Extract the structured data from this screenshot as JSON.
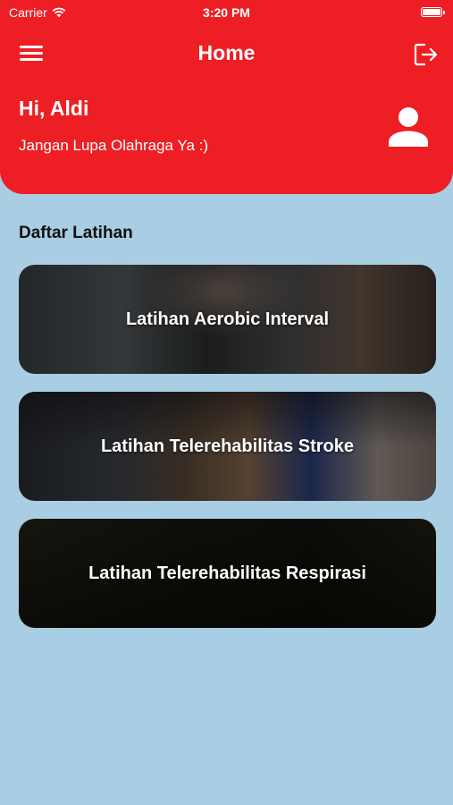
{
  "status_bar": {
    "carrier": "Carrier",
    "time": "3:20 PM",
    "icons": [
      "wifi-icon",
      "battery-icon"
    ]
  },
  "nav": {
    "title": "Home",
    "left_icon": "menu-icon",
    "right_icon": "logout-icon"
  },
  "header": {
    "greeting": "Hi, Aldi",
    "subtitle": "Jangan Lupa Olahraga Ya :)",
    "avatar_icon": "user-icon"
  },
  "section": {
    "title": "Daftar Latihan"
  },
  "exercises": [
    {
      "label": "Latihan Aerobic Interval"
    },
    {
      "label": "Latihan Telerehabilitas Stroke"
    },
    {
      "label": "Latihan Telerehabilitas Respirasi"
    }
  ],
  "colors": {
    "header_bg": "#ed1f24",
    "page_bg": "#a9cde3",
    "text_on_header": "#ffffff"
  }
}
